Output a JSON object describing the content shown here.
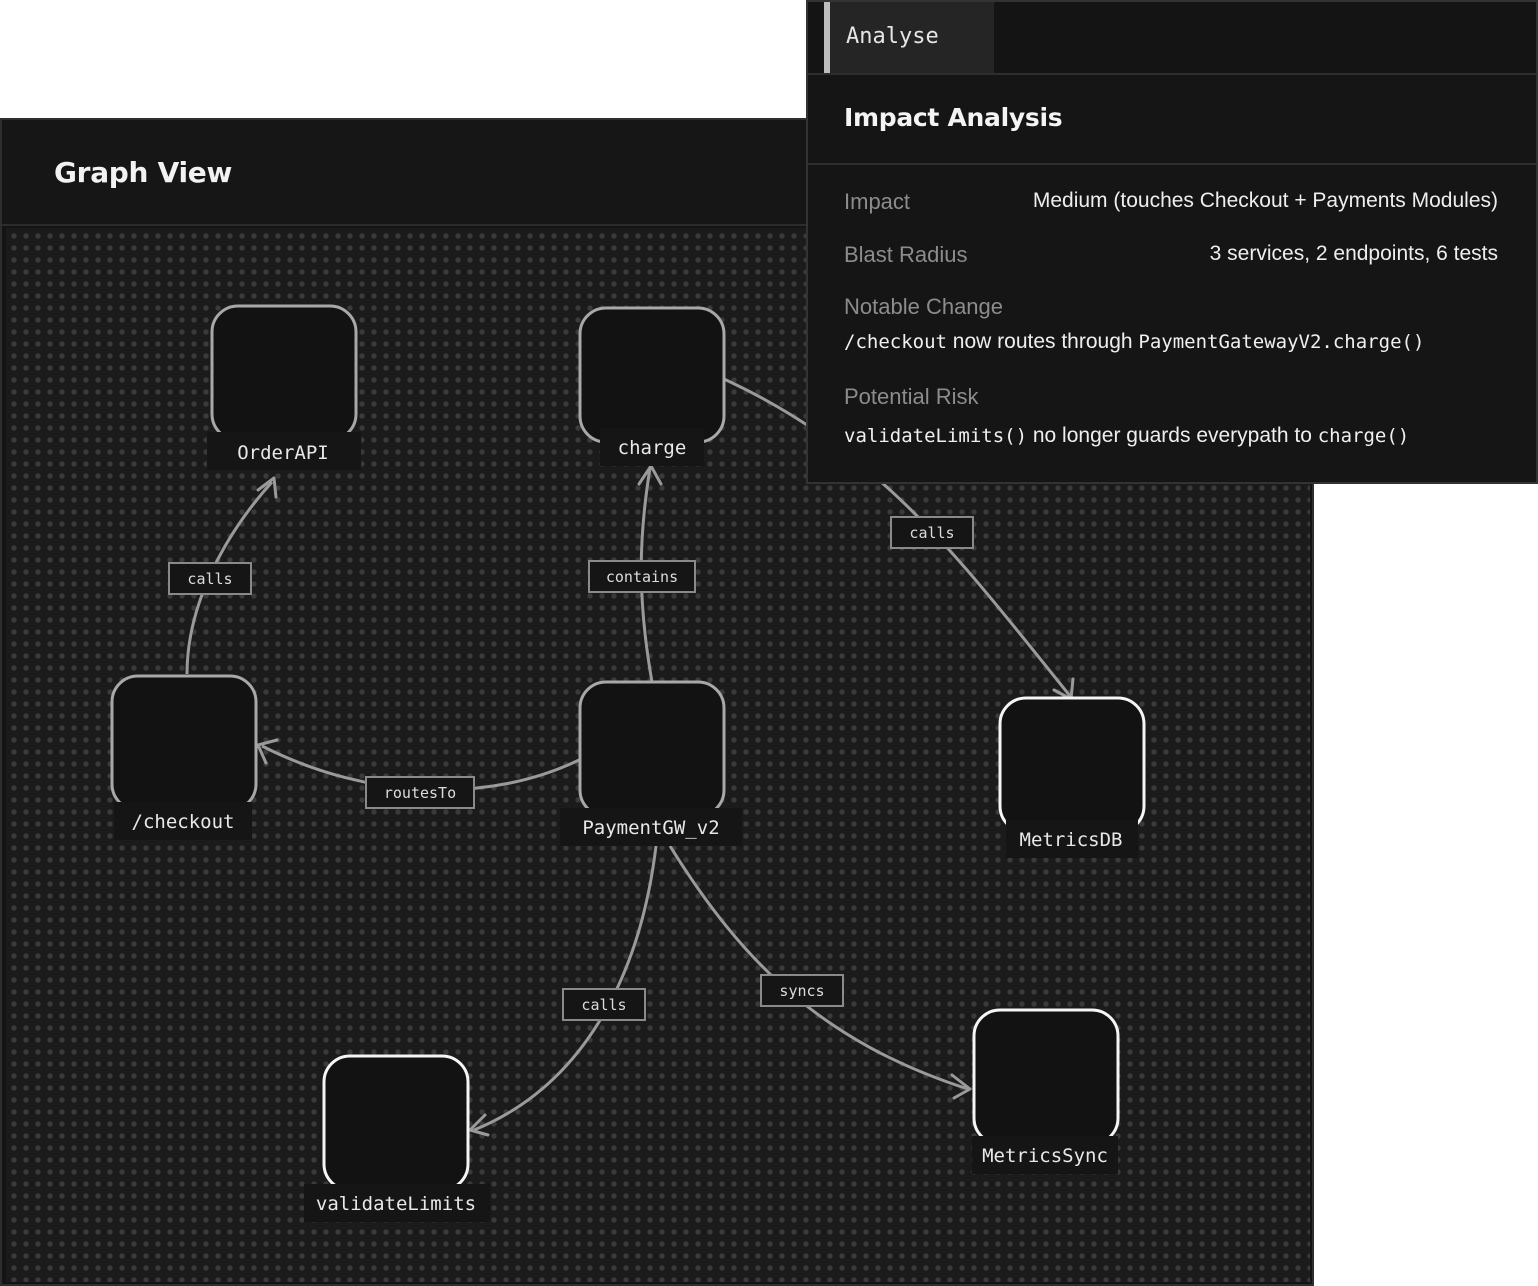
{
  "graph_view": {
    "title": "Graph View",
    "nodes": {
      "order_api": "OrderAPI",
      "charge": "charge",
      "checkout": "/checkout",
      "payment_gw": "PaymentGW_v2",
      "metrics_db": "MetricsDB",
      "validate_limits": "validateLimits",
      "metrics_sync": "MetricsSync"
    },
    "edges": {
      "checkout_orderapi": "calls",
      "paymentgw_charge": "contains",
      "charge_metricsdb": "calls",
      "paymentgw_checkout": "routesTo",
      "paymentgw_validate": "calls",
      "paymentgw_metricssync": "syncs"
    }
  },
  "analyse": {
    "tab_label": "Analyse",
    "heading": "Impact Analysis",
    "impact_label": "Impact",
    "impact_value": "Medium (touches Checkout + Payments Modules)",
    "blast_label": "Blast Radius",
    "blast_value": "3 services, 2 endpoints, 6 tests",
    "notable_label": "Notable Change",
    "notable_code_1": "/checkout",
    "notable_text": " now routes through ",
    "notable_code_2": "PaymentGatewayV2.charge()",
    "risk_label": "Potential Risk",
    "risk_code_1": "validateLimits()",
    "risk_text": " no longer guards everypath to ",
    "risk_code_2": "charge()"
  }
}
